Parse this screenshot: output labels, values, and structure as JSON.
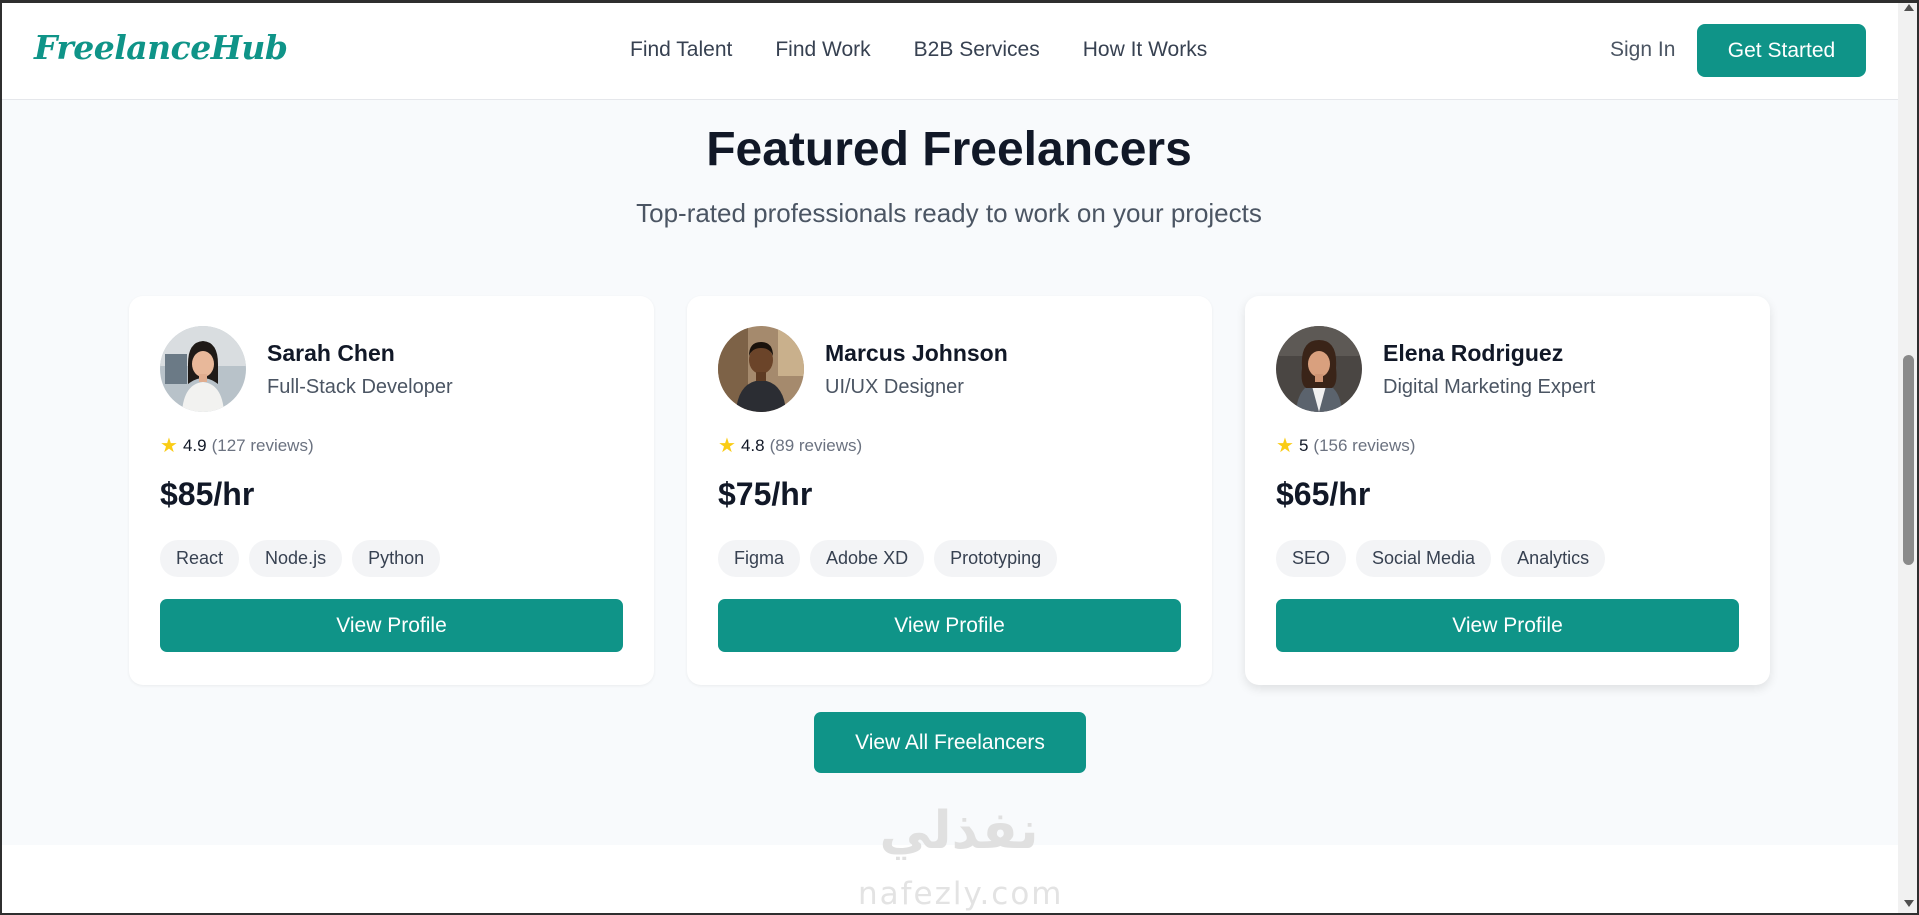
{
  "brand": {
    "name": "FreelanceHub",
    "accent": "#0f9488"
  },
  "nav": {
    "items": [
      {
        "label": "Find Talent"
      },
      {
        "label": "Find Work"
      },
      {
        "label": "B2B Services"
      },
      {
        "label": "How It Works"
      }
    ],
    "sign_in": "Sign In",
    "get_started": "Get Started"
  },
  "section": {
    "title": "Featured Freelancers",
    "subtitle": "Top-rated professionals ready to work on your projects",
    "view_all": "View All Freelancers"
  },
  "freelancers": [
    {
      "name": "Sarah Chen",
      "role": "Full-Stack Developer",
      "rating": "4.9",
      "reviews": "(127 reviews)",
      "rate": "$85/hr",
      "skills": [
        "React",
        "Node.js",
        "Python"
      ],
      "button": "View Profile",
      "avatar_icon": "woman-portrait"
    },
    {
      "name": "Marcus Johnson",
      "role": "UI/UX Designer",
      "rating": "4.8",
      "reviews": "(89 reviews)",
      "rate": "$75/hr",
      "skills": [
        "Figma",
        "Adobe XD",
        "Prototyping"
      ],
      "button": "View Profile",
      "avatar_icon": "man-portrait"
    },
    {
      "name": "Elena Rodriguez",
      "role": "Digital Marketing Expert",
      "rating": "5",
      "reviews": "(156 reviews)",
      "rate": "$65/hr",
      "skills": [
        "SEO",
        "Social Media",
        "Analytics"
      ],
      "button": "View Profile",
      "avatar_icon": "woman-portrait"
    }
  ],
  "watermark": {
    "logo_text": "نفذلي",
    "text": "nafezly.com"
  }
}
